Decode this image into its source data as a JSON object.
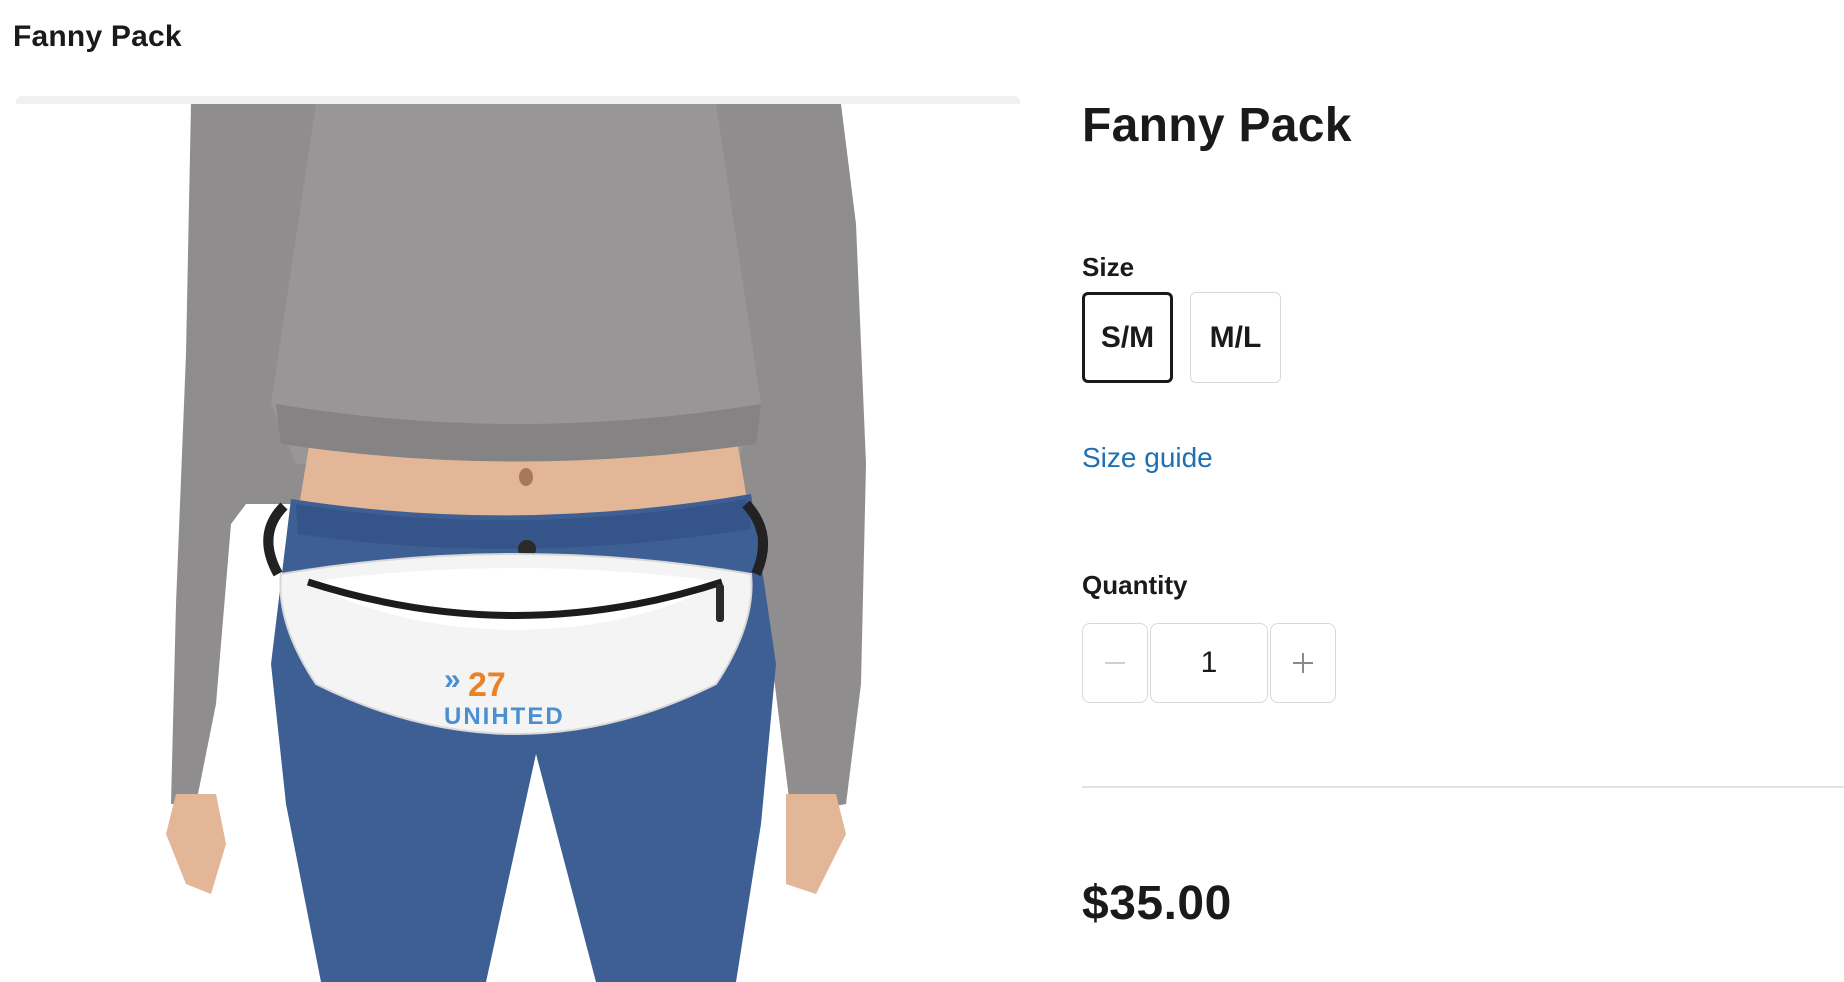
{
  "header": {
    "title": "Fanny Pack"
  },
  "product": {
    "title": "Fanny Pack",
    "image_logo_text": {
      "number": "27",
      "word": "UNIHTED"
    },
    "size": {
      "label": "Size",
      "options": [
        "S/M",
        "M/L"
      ],
      "selected": "S/M",
      "guide_link": "Size guide"
    },
    "quantity": {
      "label": "Quantity",
      "value": "1"
    },
    "price": "$35.00"
  },
  "icons": {
    "decrement": "minus-icon",
    "increment": "plus-icon"
  },
  "colors": {
    "link": "#1f6fb3",
    "text": "#1a1a1a",
    "border": "#d9d9d9",
    "logo_orange": "#e8832a",
    "logo_blue": "#4a8fd0"
  }
}
